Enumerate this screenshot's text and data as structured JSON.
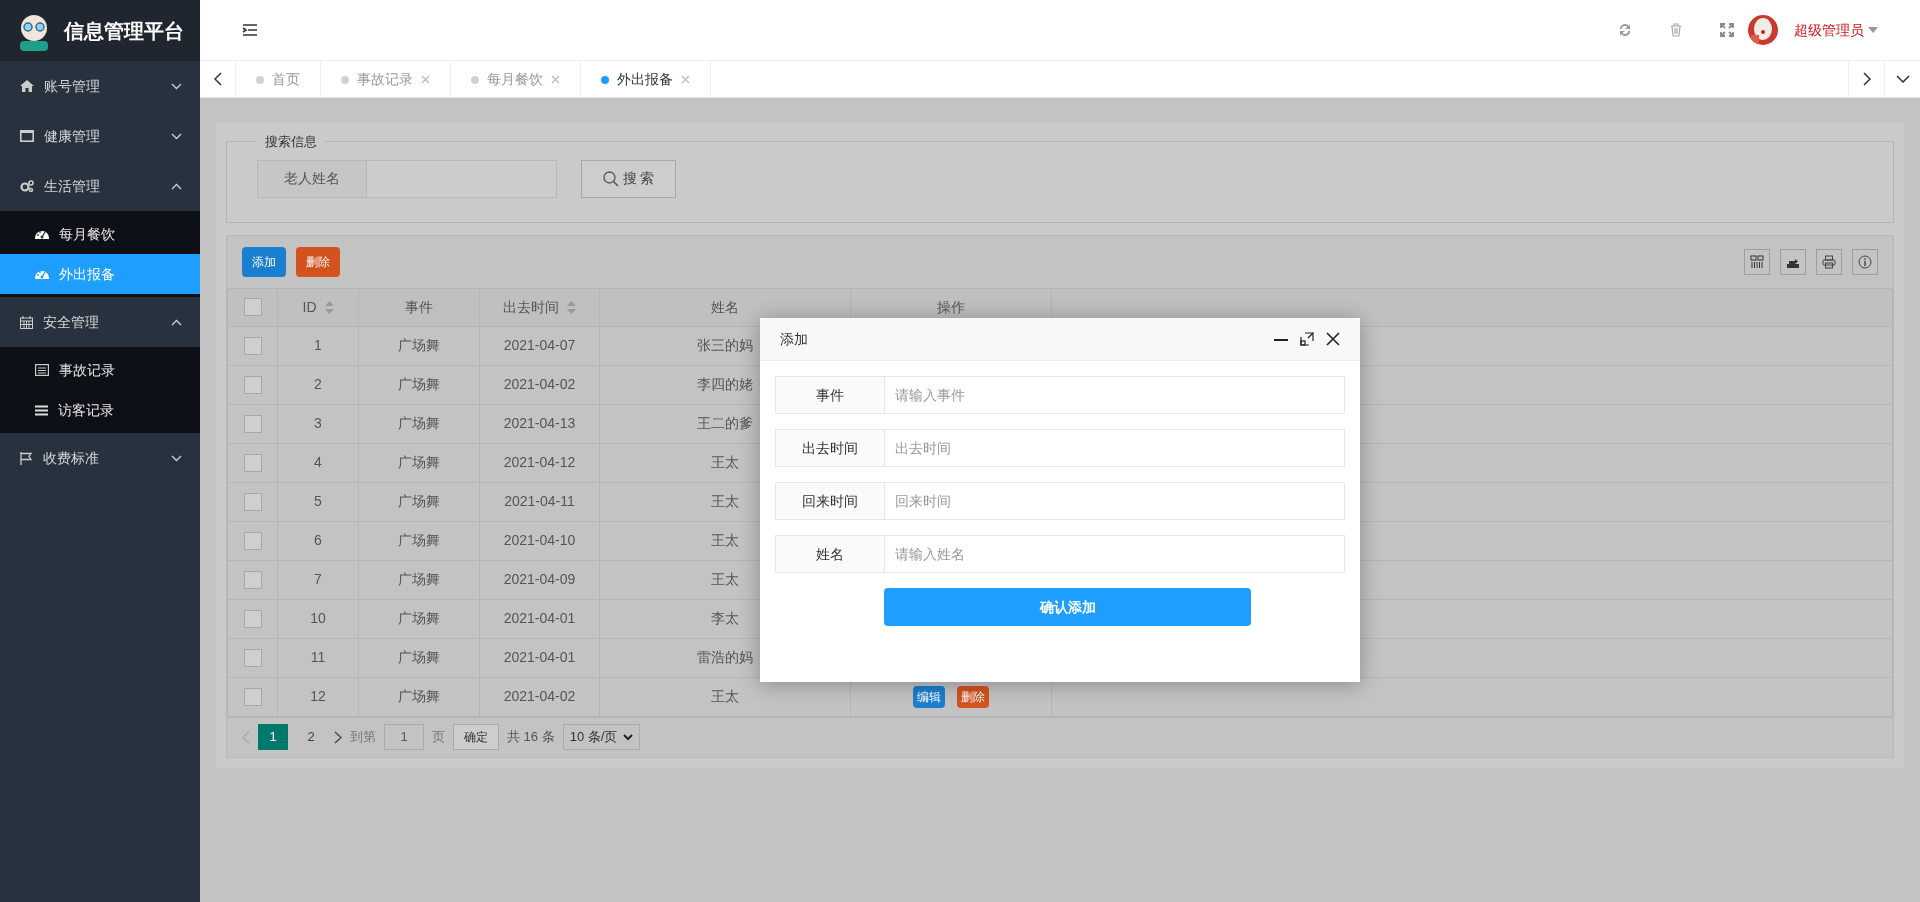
{
  "sidebar": {
    "brand": "信息管理平台",
    "menu": [
      {
        "label": "账号管理",
        "expanded": false
      },
      {
        "label": "健康管理",
        "expanded": false
      },
      {
        "label": "生活管理",
        "expanded": true,
        "children": [
          {
            "label": "每月餐饮",
            "selected": false
          },
          {
            "label": "外出报备",
            "selected": true
          }
        ]
      },
      {
        "label": "安全管理",
        "expanded": true,
        "children": [
          {
            "label": "事故记录",
            "selected": false
          },
          {
            "label": "访客记录",
            "selected": false
          }
        ]
      },
      {
        "label": "收费标准",
        "expanded": false
      }
    ]
  },
  "header": {
    "user": "超级管理员"
  },
  "tabs": [
    {
      "label": "首页",
      "selected": false,
      "closable": false
    },
    {
      "label": "事故记录",
      "selected": false,
      "closable": true
    },
    {
      "label": "每月餐饮",
      "selected": false,
      "closable": true
    },
    {
      "label": "外出报备",
      "selected": true,
      "closable": true
    }
  ],
  "search": {
    "legend": "搜索信息",
    "label": "老人姓名",
    "button": "搜 索"
  },
  "table": {
    "toolbar": [
      "添加",
      "删除"
    ],
    "header_checked": false,
    "columns": [
      {
        "label": "ID",
        "sortable": true
      },
      {
        "label": "事件",
        "sortable": false
      },
      {
        "label": "出去时间",
        "sortable": true
      },
      {
        "label": "姓名",
        "sortable": false
      },
      {
        "label": "操作",
        "sortable": false
      }
    ],
    "rows": [
      {
        "checked": false,
        "cells": [
          "1",
          "广场舞",
          "2021-04-07",
          "张三的妈"
        ]
      },
      {
        "checked": false,
        "cells": [
          "2",
          "广场舞",
          "2021-04-02",
          "李四的姥"
        ]
      },
      {
        "checked": false,
        "cells": [
          "3",
          "广场舞",
          "2021-04-13",
          "王二的爹"
        ]
      },
      {
        "checked": false,
        "cells": [
          "4",
          "广场舞",
          "2021-04-12",
          "王太"
        ]
      },
      {
        "checked": false,
        "cells": [
          "5",
          "广场舞",
          "2021-04-11",
          "王太"
        ]
      },
      {
        "checked": false,
        "cells": [
          "6",
          "广场舞",
          "2021-04-10",
          "王太"
        ]
      },
      {
        "checked": false,
        "cells": [
          "7",
          "广场舞",
          "2021-04-09",
          "王太"
        ]
      },
      {
        "checked": false,
        "cells": [
          "10",
          "广场舞",
          "2021-04-01",
          "李太"
        ]
      },
      {
        "checked": false,
        "cells": [
          "11",
          "广场舞",
          "2021-04-01",
          "雷浩的妈"
        ]
      },
      {
        "checked": false,
        "cells": [
          "12",
          "广场舞",
          "2021-04-02",
          "王太"
        ],
        "actions": [
          "编辑",
          "删除"
        ]
      }
    ]
  },
  "pagination": {
    "pages": [
      {
        "label": "1",
        "selected": true
      },
      {
        "label": "2",
        "selected": false
      }
    ],
    "goto_label": "到第",
    "goto_value": "1",
    "page_unit": "页",
    "confirm": "确定",
    "total": "共 16 条",
    "page_size": "10 条/页"
  },
  "modal": {
    "title": "添加",
    "fields": [
      {
        "label": "事件",
        "placeholder": "请输入事件"
      },
      {
        "label": "出去时间",
        "placeholder": "出去时间"
      },
      {
        "label": "回来时间",
        "placeholder": "回来时间"
      },
      {
        "label": "姓名",
        "placeholder": "请输入姓名"
      }
    ],
    "submit": "确认添加"
  }
}
